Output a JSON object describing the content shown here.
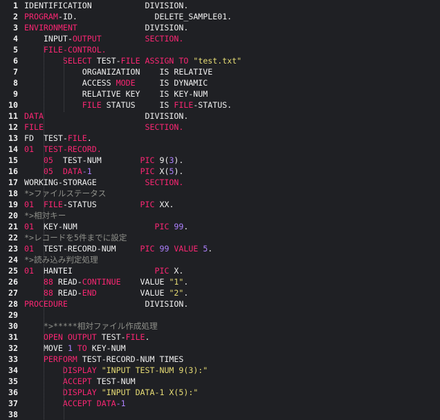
{
  "editor": {
    "colors": {
      "background": "#1f2024",
      "keyword": "#f92672",
      "string": "#e6db74",
      "number": "#ae81ff",
      "comment": "#8f908a",
      "text": "#e8e8e8"
    },
    "lines": [
      {
        "n": "1",
        "t": [
          [
            "IDENTIFICATION           DIVISION.",
            "kw"
          ]
        ]
      },
      {
        "n": "2",
        "t": [
          [
            "PROGRAM",
            "p"
          ],
          [
            "-ID.                DELETE_SAMPLE01.",
            "kw"
          ]
        ]
      },
      {
        "n": "3",
        "t": [
          [
            "ENVIRONMENT",
            "p"
          ],
          [
            "              DIVISION.",
            "kw"
          ]
        ]
      },
      {
        "n": "4",
        "t": [
          [
            "    INPUT-",
            "kw"
          ],
          [
            "OUTPUT",
            "p"
          ],
          [
            "         ",
            "kw"
          ],
          [
            "SECTION.",
            "p"
          ]
        ]
      },
      {
        "n": "5",
        "t": [
          [
            "    ",
            "kw"
          ],
          [
            "FILE",
            "p"
          ],
          [
            "-CONTROL.",
            "p"
          ]
        ]
      },
      {
        "n": "6",
        "t": [
          [
            "        ",
            "kw"
          ],
          [
            "SELECT",
            "p"
          ],
          [
            " TEST-",
            "kw"
          ],
          [
            "FILE",
            "p"
          ],
          [
            " ",
            "kw"
          ],
          [
            "ASSIGN",
            "p"
          ],
          [
            " ",
            "kw"
          ],
          [
            "TO",
            "p"
          ],
          [
            " ",
            "kw"
          ],
          [
            "\"test.txt\"",
            "s"
          ]
        ]
      },
      {
        "n": "7",
        "t": [
          [
            "            ORGANIZATION    IS RELATIVE",
            "kw"
          ]
        ]
      },
      {
        "n": "8",
        "t": [
          [
            "            ACCESS ",
            "kw"
          ],
          [
            "MODE",
            "p"
          ],
          [
            "     IS DYNAMIC",
            "kw"
          ]
        ]
      },
      {
        "n": "9",
        "t": [
          [
            "            RELATIVE KEY    IS KEY-NUM",
            "kw"
          ]
        ]
      },
      {
        "n": "10",
        "t": [
          [
            "            ",
            "kw"
          ],
          [
            "FILE",
            "p"
          ],
          [
            " STATUS     IS ",
            "kw"
          ],
          [
            "FILE",
            "p"
          ],
          [
            "-STATUS.",
            "kw"
          ]
        ]
      },
      {
        "n": "11",
        "t": [
          [
            "DATA",
            "p"
          ],
          [
            "                     DIVISION.",
            "kw"
          ]
        ]
      },
      {
        "n": "12",
        "t": [
          [
            "FILE",
            "p"
          ],
          [
            "                     ",
            "kw"
          ],
          [
            "SECTION.",
            "p"
          ]
        ]
      },
      {
        "n": "13",
        "t": [
          [
            "FD  TEST-",
            "kw"
          ],
          [
            "FILE",
            "p"
          ],
          [
            ".",
            "kw"
          ]
        ]
      },
      {
        "n": "14",
        "t": [
          [
            "01",
            "p"
          ],
          [
            "  TEST-RECORD.",
            "p"
          ]
        ]
      },
      {
        "n": "15",
        "t": [
          [
            "    ",
            "kw"
          ],
          [
            "05",
            "p"
          ],
          [
            "  TEST-NUM        ",
            "kw"
          ],
          [
            "PIC",
            "p"
          ],
          [
            " 9(",
            "kw"
          ],
          [
            "3",
            "n"
          ],
          [
            ").",
            "kw"
          ]
        ]
      },
      {
        "n": "16",
        "t": [
          [
            "    ",
            "kw"
          ],
          [
            "05",
            "p"
          ],
          [
            "  ",
            "kw"
          ],
          [
            "DATA",
            "p"
          ],
          [
            "-1",
            "n"
          ],
          [
            "          ",
            "kw"
          ],
          [
            "PIC",
            "p"
          ],
          [
            " X(",
            "kw"
          ],
          [
            "5",
            "n"
          ],
          [
            ").",
            "kw"
          ]
        ]
      },
      {
        "n": "17",
        "t": [
          [
            "WORKING-STORAGE          ",
            "kw"
          ],
          [
            "SECTION.",
            "p"
          ]
        ]
      },
      {
        "n": "18",
        "t": [
          [
            "*>ファイルステータス",
            "c"
          ]
        ]
      },
      {
        "n": "19",
        "t": [
          [
            "01",
            "p"
          ],
          [
            "  ",
            "kw"
          ],
          [
            "FILE",
            "p"
          ],
          [
            "-STATUS         ",
            "kw"
          ],
          [
            "PIC",
            "p"
          ],
          [
            " XX.",
            "kw"
          ]
        ]
      },
      {
        "n": "20",
        "t": [
          [
            "*>相対キー",
            "c"
          ]
        ]
      },
      {
        "n": "21",
        "t": [
          [
            "01",
            "p"
          ],
          [
            "  KEY-NUM                ",
            "kw"
          ],
          [
            "PIC",
            "p"
          ],
          [
            " ",
            "kw"
          ],
          [
            "99",
            "n"
          ],
          [
            ".",
            "kw"
          ]
        ]
      },
      {
        "n": "22",
        "t": [
          [
            "*>レコードを5件までに設定",
            "c"
          ]
        ]
      },
      {
        "n": "23",
        "t": [
          [
            "01",
            "p"
          ],
          [
            "  TEST-RECORD-NUM     ",
            "kw"
          ],
          [
            "PIC",
            "p"
          ],
          [
            " ",
            "kw"
          ],
          [
            "99",
            "n"
          ],
          [
            " ",
            "kw"
          ],
          [
            "VALUE",
            "p"
          ],
          [
            " ",
            "kw"
          ],
          [
            "5",
            "n"
          ],
          [
            ".",
            "kw"
          ]
        ]
      },
      {
        "n": "24",
        "t": [
          [
            "*>読み込み判定処理",
            "c"
          ]
        ]
      },
      {
        "n": "25",
        "t": [
          [
            "01",
            "p"
          ],
          [
            "  HANTEI                 ",
            "kw"
          ],
          [
            "PIC",
            "p"
          ],
          [
            " X.",
            "kw"
          ]
        ]
      },
      {
        "n": "26",
        "t": [
          [
            "    ",
            "kw"
          ],
          [
            "88",
            "p"
          ],
          [
            " READ-",
            "kw"
          ],
          [
            "CONTINUE",
            "p"
          ],
          [
            "    VALUE ",
            "kw"
          ],
          [
            "\"1\"",
            "s"
          ],
          [
            ".",
            "kw"
          ]
        ]
      },
      {
        "n": "27",
        "t": [
          [
            "    ",
            "kw"
          ],
          [
            "88",
            "p"
          ],
          [
            " READ-",
            "kw"
          ],
          [
            "END",
            "p"
          ],
          [
            "         VALUE ",
            "kw"
          ],
          [
            "\"2\"",
            "s"
          ],
          [
            ".",
            "kw"
          ]
        ]
      },
      {
        "n": "28",
        "t": [
          [
            "PROCEDURE",
            "p"
          ],
          [
            "                DIVISION.",
            "kw"
          ]
        ]
      },
      {
        "n": "29",
        "t": [
          [
            "",
            "kw"
          ]
        ]
      },
      {
        "n": "30",
        "t": [
          [
            "    *>*****相対ファイル作成処理",
            "c"
          ]
        ]
      },
      {
        "n": "31",
        "t": [
          [
            "    ",
            "kw"
          ],
          [
            "OPEN",
            "p"
          ],
          [
            " ",
            "kw"
          ],
          [
            "OUTPUT",
            "p"
          ],
          [
            " TEST-",
            "kw"
          ],
          [
            "FILE",
            "p"
          ],
          [
            ".",
            "kw"
          ]
        ]
      },
      {
        "n": "32",
        "t": [
          [
            "    MOVE ",
            "kw"
          ],
          [
            "1",
            "n"
          ],
          [
            " ",
            "kw"
          ],
          [
            "TO",
            "p"
          ],
          [
            " KEY-NUM",
            "kw"
          ]
        ]
      },
      {
        "n": "33",
        "t": [
          [
            "    ",
            "kw"
          ],
          [
            "PERFORM",
            "p"
          ],
          [
            " TEST-RECORD-NUM TIMES",
            "kw"
          ]
        ]
      },
      {
        "n": "34",
        "t": [
          [
            "        ",
            "kw"
          ],
          [
            "DISPLAY",
            "p"
          ],
          [
            " ",
            "kw"
          ],
          [
            "\"INPUT TEST-NUM 9(3):\"",
            "s"
          ]
        ]
      },
      {
        "n": "35",
        "t": [
          [
            "        ",
            "kw"
          ],
          [
            "ACCEPT",
            "p"
          ],
          [
            " TEST-NUM",
            "kw"
          ]
        ]
      },
      {
        "n": "36",
        "t": [
          [
            "        ",
            "kw"
          ],
          [
            "DISPLAY",
            "p"
          ],
          [
            " ",
            "kw"
          ],
          [
            "\"INPUT DATA-1 X(5):\"",
            "s"
          ]
        ]
      },
      {
        "n": "37",
        "t": [
          [
            "        ",
            "kw"
          ],
          [
            "ACCEPT",
            "p"
          ],
          [
            " ",
            "kw"
          ],
          [
            "DATA",
            "p"
          ],
          [
            "-1",
            "n"
          ]
        ]
      },
      {
        "n": "38",
        "t": [
          [
            "",
            "kw"
          ]
        ]
      }
    ]
  }
}
